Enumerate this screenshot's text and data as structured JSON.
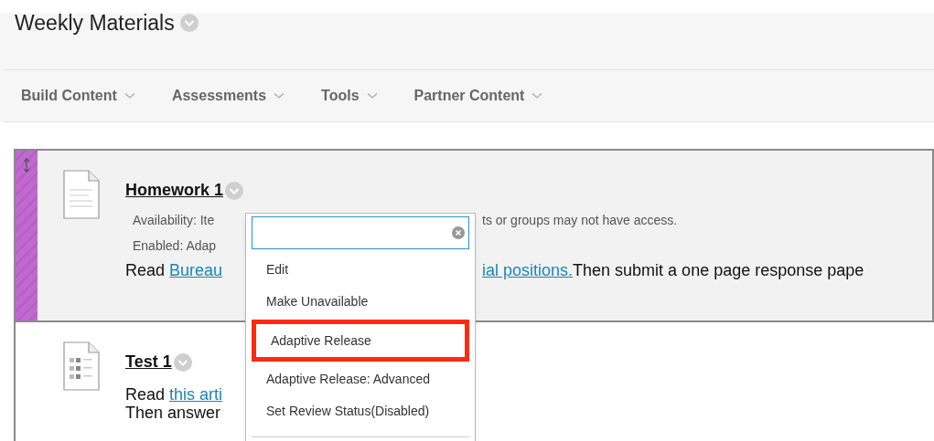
{
  "page_title": "Weekly Materials",
  "toolbar": [
    {
      "label": "Build Content"
    },
    {
      "label": "Assessments"
    },
    {
      "label": "Tools"
    },
    {
      "label": "Partner Content"
    }
  ],
  "items": [
    {
      "kind": "document",
      "title": "Homework 1",
      "selected": true,
      "details": [
        {
          "left": "Availability:  Ite",
          "right": "ts or groups may not have access."
        },
        {
          "left": "Enabled:  Adap"
        }
      ],
      "body": [
        {
          "left": [
            {
              "text": "Read ",
              "link": false
            },
            {
              "text": "Bureau",
              "link": true
            }
          ],
          "right": [
            {
              "text": "ial positions.",
              "link": true
            },
            {
              "text": "Then submit a one page response pape",
              "link": false
            }
          ]
        }
      ]
    },
    {
      "kind": "test",
      "title": "Test 1",
      "selected": false,
      "body": [
        {
          "left": [
            {
              "text": "Read ",
              "link": false
            },
            {
              "text": "this arti",
              "link": true
            }
          ]
        },
        {
          "left": [
            {
              "text": "Then answer",
              "link": false
            }
          ]
        }
      ]
    }
  ],
  "menu": {
    "items": [
      {
        "label": "Edit",
        "selected": false
      },
      {
        "label": "Make Unavailable",
        "selected": false
      },
      {
        "label": "Adaptive Release",
        "selected": true
      },
      {
        "label": "Adaptive Release: Advanced",
        "selected": false
      },
      {
        "label": "Set Review Status(Disabled)",
        "selected": false
      }
    ]
  }
}
